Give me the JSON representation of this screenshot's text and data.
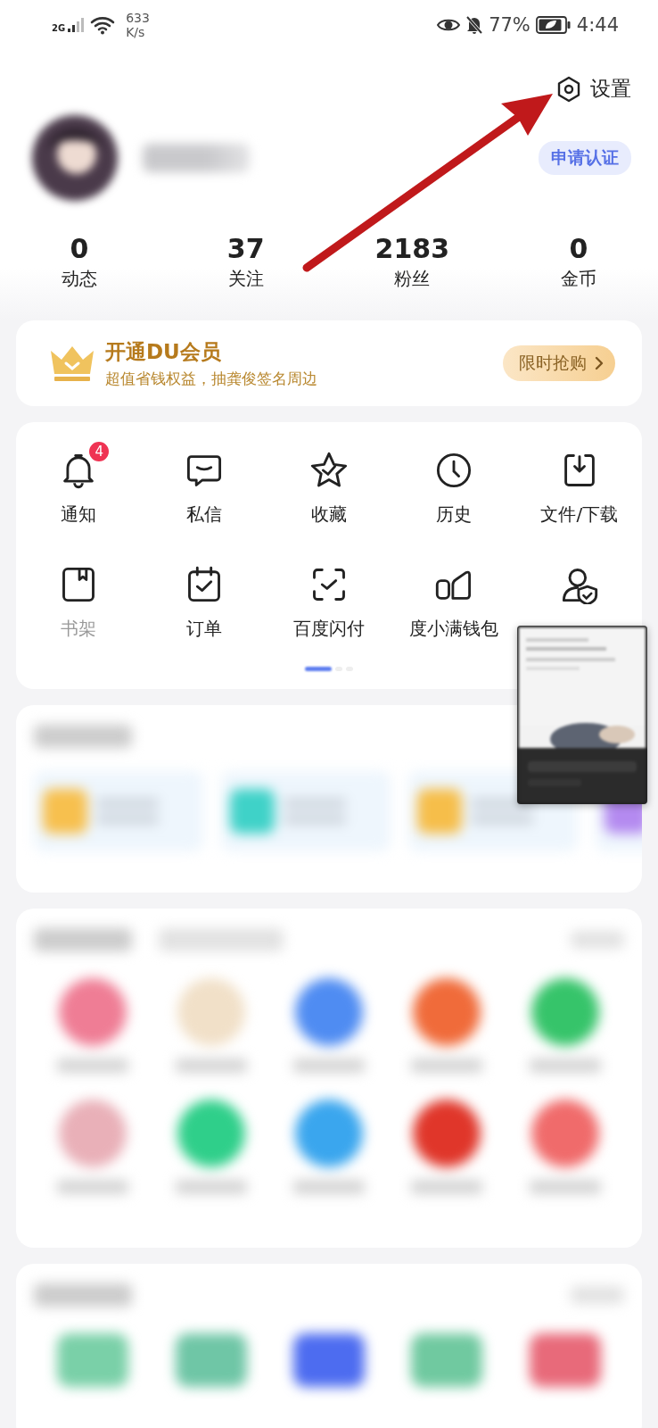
{
  "status_bar": {
    "network": "2G",
    "speed_value": "633",
    "speed_unit": "K/s",
    "battery": "77%",
    "time": "4:44"
  },
  "header": {
    "settings_label": "设置",
    "verify_button": "申请认证"
  },
  "stats": [
    {
      "value": "0",
      "label": "动态"
    },
    {
      "value": "37",
      "label": "关注"
    },
    {
      "value": "2183",
      "label": "粉丝"
    },
    {
      "value": "0",
      "label": "金币"
    }
  ],
  "vip": {
    "title": "开通DU会员",
    "subtitle": "超值省钱权益，抽龚俊签名周边",
    "button": "限时抢购"
  },
  "shortcuts": [
    {
      "kind": "bell",
      "label": "通知",
      "badge": "4"
    },
    {
      "kind": "chat",
      "label": "私信"
    },
    {
      "kind": "star",
      "label": "收藏"
    },
    {
      "kind": "clock",
      "label": "历史"
    },
    {
      "kind": "download",
      "label": "文件/下载"
    },
    {
      "kind": "book",
      "label": "书架",
      "faded": true
    },
    {
      "kind": "calendar",
      "label": "订单"
    },
    {
      "kind": "scan",
      "label": "百度闪付"
    },
    {
      "kind": "wallet",
      "label": "度小满钱包"
    },
    {
      "kind": "shield"
    }
  ],
  "pager": [
    {
      "selected": true
    },
    {
      "selected": false
    },
    {
      "selected": false
    }
  ],
  "annotation": {
    "kind": "arrow"
  }
}
